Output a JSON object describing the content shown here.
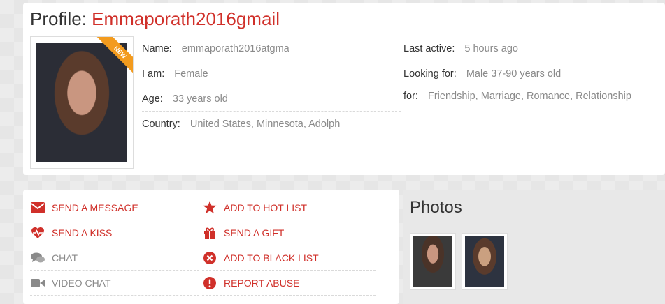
{
  "profile": {
    "title_prefix": "Profile:",
    "username": "Emmaporath2016gmail",
    "badge": "NEW",
    "left": [
      {
        "label": "Name:",
        "value": "emmaporath2016atgma"
      },
      {
        "label": "I am:",
        "value": "Female"
      },
      {
        "label": "Age:",
        "value": "33 years old"
      },
      {
        "label": "Country:",
        "value": "United States, Minnesota, Adolph"
      }
    ],
    "right": [
      {
        "label": "Last active:",
        "value": "5 hours ago"
      },
      {
        "label": "Looking for:",
        "value": "Male 37-90 years old"
      },
      {
        "label": "for:",
        "value": "Friendship, Marriage, Romance, Relationship"
      }
    ]
  },
  "actions": {
    "col1": [
      {
        "label": "Send a message",
        "icon": "envelope-icon",
        "style": "red"
      },
      {
        "label": "Send a kiss",
        "icon": "heart-pulse-icon",
        "style": "red"
      },
      {
        "label": "Chat",
        "icon": "chat-bubbles-icon",
        "style": "grey"
      },
      {
        "label": "Video chat",
        "icon": "video-camera-icon",
        "style": "grey"
      }
    ],
    "col2": [
      {
        "label": "Add to hot list",
        "icon": "star-icon",
        "style": "red"
      },
      {
        "label": "Send a gift",
        "icon": "gift-icon",
        "style": "red"
      },
      {
        "label": "Add to black list",
        "icon": "close-circle-icon",
        "style": "red"
      },
      {
        "label": "Report abuse",
        "icon": "exclamation-circle-icon",
        "style": "red"
      }
    ]
  },
  "photos": {
    "heading": "Photos",
    "count": 2
  },
  "colors": {
    "accent": "#d0302a",
    "grey_text": "#8a8a8a",
    "badge": "#f39b1e"
  }
}
